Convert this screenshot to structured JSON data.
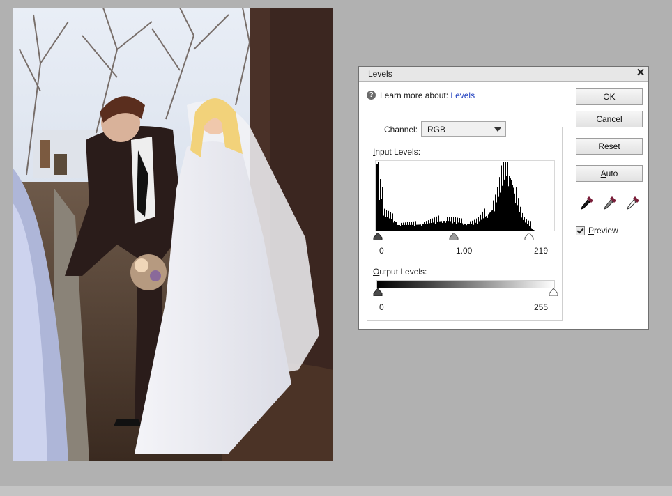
{
  "dialog": {
    "title": "Levels",
    "learn_prefix": "Learn more about:",
    "learn_link": "Levels",
    "channel_label": "Channel:",
    "channel_value": "RGB",
    "input_levels_label_first": "I",
    "input_levels_label_rest": "nput Levels:",
    "output_levels_label_first": "O",
    "output_levels_label_rest": "utput Levels:",
    "input_black": "0",
    "input_gamma": "1.00",
    "input_white": "219",
    "output_black": "0",
    "output_white": "255",
    "ok_label": "OK",
    "cancel_label": "Cancel",
    "reset_first": "R",
    "reset_rest": "eset",
    "auto_first": "A",
    "auto_rest": "uto",
    "preview_first": "P",
    "preview_rest": "review",
    "preview_checked": true,
    "close_glyph": "✕",
    "help_glyph": "?"
  },
  "icons": {
    "help": "help-circle-icon",
    "close": "close-icon",
    "black_point": "eyedropper-black-icon",
    "gray_point": "eyedropper-gray-icon",
    "white_point": "eyedropper-white-icon"
  },
  "colors": {
    "background": "#b1b1b1",
    "link": "#1f3fbf",
    "histogram": "#000000"
  }
}
